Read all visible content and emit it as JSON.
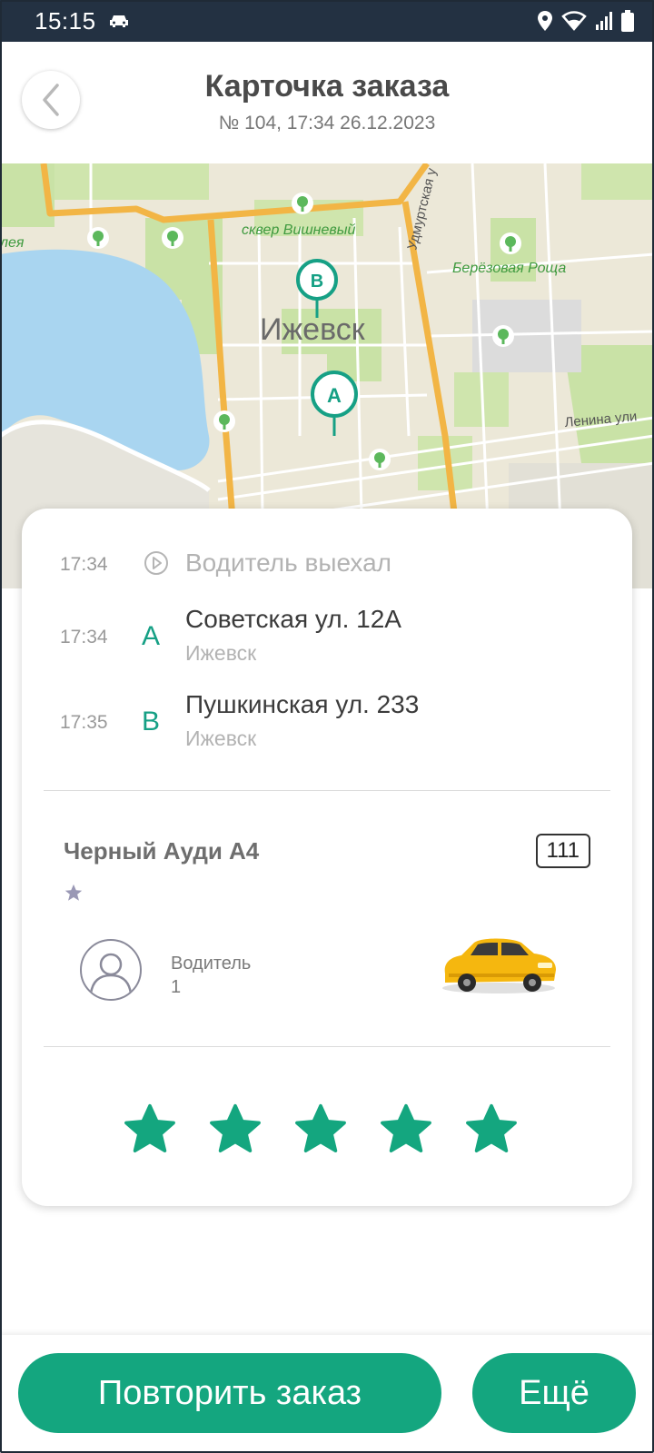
{
  "status_bar": {
    "time": "15:15",
    "icons": [
      "car-icon",
      "location-icon",
      "wifi-icon",
      "signal-icon",
      "battery-icon"
    ]
  },
  "header": {
    "title": "Карточка заказа",
    "subtitle": "№ 104, 17:34 26.12.2023",
    "back_icon": "chevron-left-icon"
  },
  "map": {
    "city_label": "Ижевск",
    "labels": [
      "сквер Вишневый",
      "Берёзовая Роща",
      "Удмуртская у",
      "Ленина ули",
      "лея"
    ],
    "pin_a": "A",
    "pin_b": "B"
  },
  "route": [
    {
      "time": "17:34",
      "icon": "play-circle-icon",
      "text": "Водитель выехал"
    },
    {
      "time": "17:34",
      "marker": "A",
      "address": "Советская ул. 12А",
      "city": "Ижевск"
    },
    {
      "time": "17:35",
      "marker": "B",
      "address": "Пушкинская ул. 233",
      "city": "Ижевск"
    }
  ],
  "car": {
    "name": "Черный Ауди А4",
    "number": "111",
    "driver_label": "Водитель",
    "driver_value": "1"
  },
  "rating": {
    "stars": 5,
    "max": 5
  },
  "colors": {
    "accent": "#14a67f",
    "status_bar": "#233142"
  },
  "buttons": {
    "repeat": "Повторить заказ",
    "more": "Ещё"
  }
}
